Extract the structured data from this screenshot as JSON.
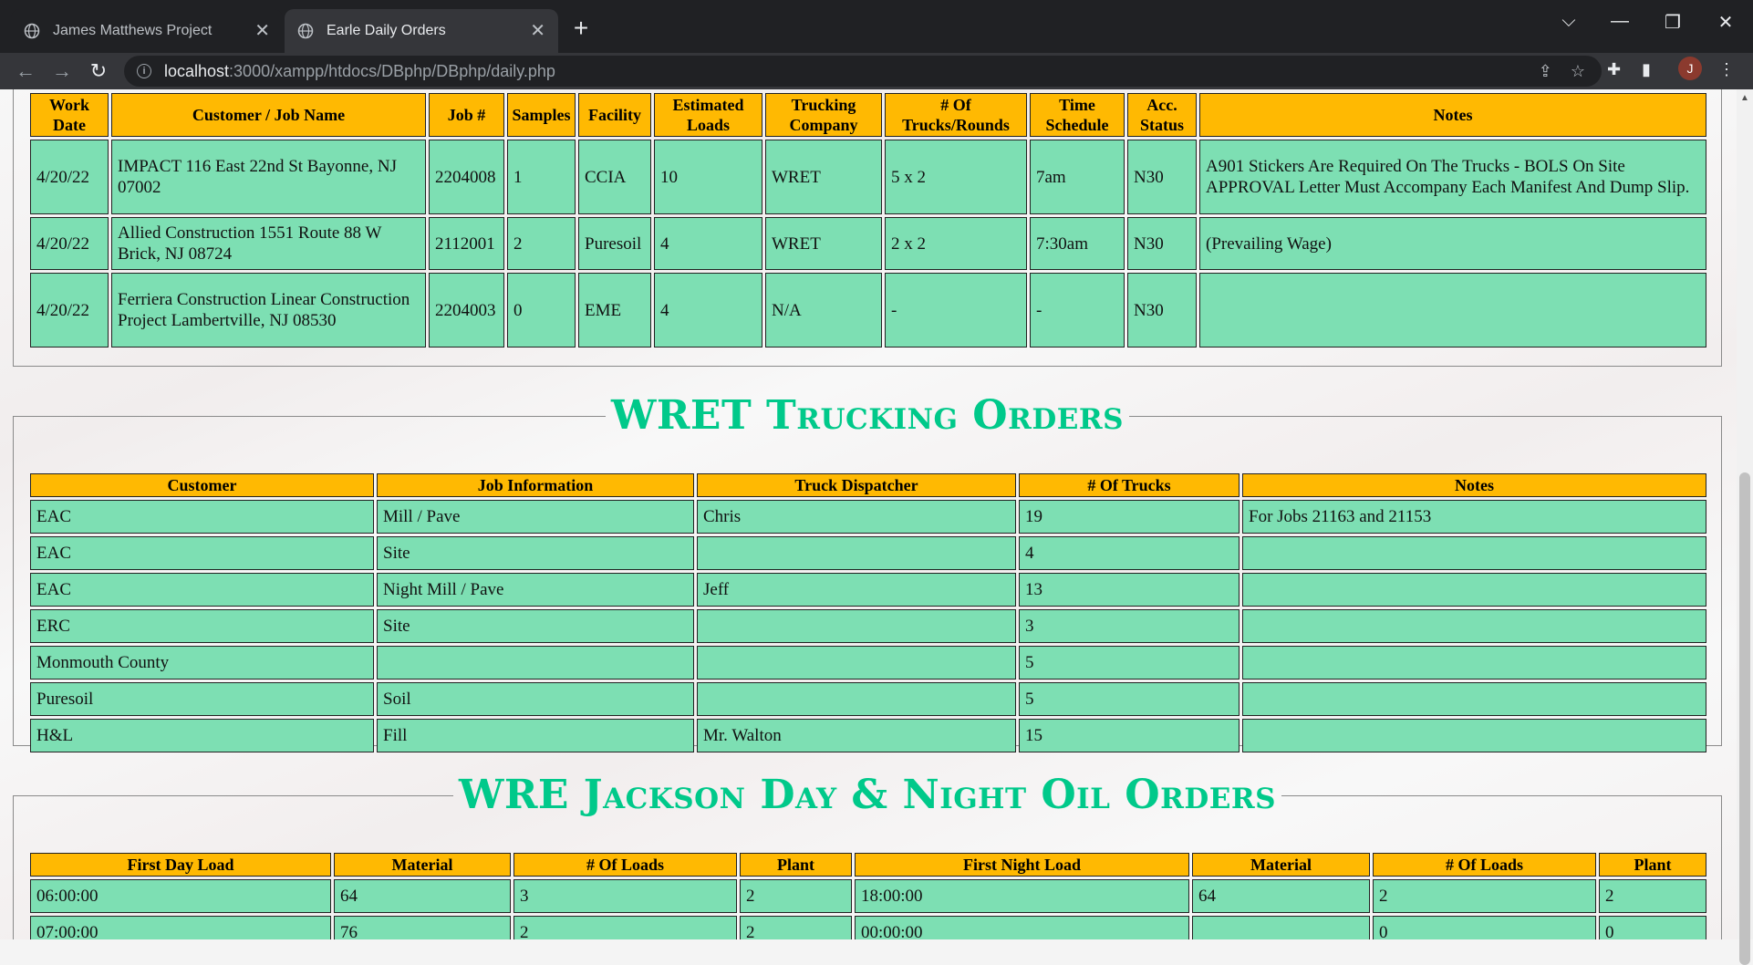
{
  "browser": {
    "tabs": [
      {
        "title": "James Matthews Project"
      },
      {
        "title": "Earle Daily Orders"
      }
    ],
    "url": {
      "host": "localhost",
      "path": ":3000/xampp/htdocs/DBphp/DBphp/daily.php"
    },
    "avatar": "J"
  },
  "orders": {
    "headers": [
      "Work Date",
      "Customer / Job Name",
      "Job #",
      "Samples",
      "Facility",
      "Estimated Loads",
      "Trucking Company",
      "# Of Trucks/Rounds",
      "Time Schedule",
      "Acc. Status",
      "Notes"
    ],
    "rows": [
      [
        "4/20/22",
        "IMPACT 116 East 22nd St Bayonne, NJ 07002",
        "2204008",
        "1",
        "CCIA",
        "10",
        "WRET",
        "5 x 2",
        "7am",
        "N30",
        "A901 Stickers Are Required On The Trucks - BOLS On Site APPROVAL Letter Must Accompany Each Manifest And Dump Slip."
      ],
      [
        "4/20/22",
        "Allied Construction 1551 Route 88 W Brick, NJ 08724",
        "2112001",
        "2",
        "Puresoil",
        "4",
        "WRET",
        "2 x 2",
        "7:30am",
        "N30",
        "(Prevailing Wage)"
      ],
      [
        "4/20/22",
        "Ferriera Construction Linear Construction Project Lambertville, NJ 08530",
        "2204003",
        "0",
        "EME",
        "4",
        "N/A",
        "-",
        "-",
        "N30",
        ""
      ]
    ]
  },
  "wret": {
    "title": "WRET Trucking Orders",
    "headers": [
      "Customer",
      "Job Information",
      "Truck Dispatcher",
      "# Of Trucks",
      "Notes"
    ],
    "rows": [
      [
        "EAC",
        "Mill / Pave",
        "Chris",
        "19",
        "For Jobs 21163 and 21153"
      ],
      [
        "EAC",
        "Site",
        "",
        "4",
        ""
      ],
      [
        "EAC",
        "Night Mill / Pave",
        "Jeff",
        "13",
        ""
      ],
      [
        "ERC",
        "Site",
        "",
        "3",
        ""
      ],
      [
        "Monmouth County",
        "",
        "",
        "5",
        ""
      ],
      [
        "Puresoil",
        "Soil",
        "",
        "5",
        ""
      ],
      [
        "H&L",
        "Fill",
        "Mr. Walton",
        "15",
        ""
      ]
    ]
  },
  "oil": {
    "title": "WRE Jackson Day & Night Oil Orders",
    "headers": [
      "First Day Load",
      "Material",
      "# Of Loads",
      "Plant",
      "First Night Load",
      "Material",
      "# Of Loads",
      "Plant"
    ],
    "rows": [
      [
        "06:00:00",
        "64",
        "3",
        "2",
        "18:00:00",
        "64",
        "2",
        "2"
      ],
      [
        "07:00:00",
        "76",
        "2",
        "2",
        "00:00:00",
        "",
        "0",
        "0"
      ]
    ]
  }
}
